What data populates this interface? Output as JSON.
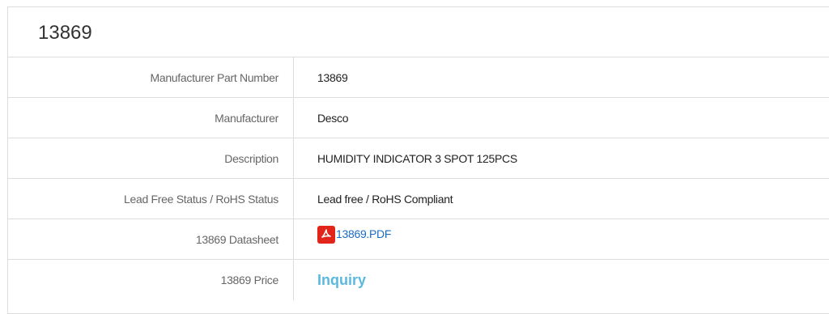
{
  "panel": {
    "title": "13869"
  },
  "rows": [
    {
      "label": "Manufacturer Part Number",
      "value": "13869"
    },
    {
      "label": "Manufacturer",
      "value": "Desco"
    },
    {
      "label": "Description",
      "value": "HUMIDITY INDICATOR 3 SPOT 125PCS"
    },
    {
      "label": "Lead Free Status / RoHS Status",
      "value": "Lead free / RoHS Compliant"
    },
    {
      "label": "13869 Datasheet",
      "link_text": "13869.PDF",
      "icon": "pdf-icon"
    },
    {
      "label": "13869 Price",
      "link_text": "Inquiry"
    }
  ],
  "colors": {
    "link": "#1a6bc4",
    "inquiry": "#5bb9de",
    "pdf_icon": "#e1251b",
    "border": "#dddddd"
  }
}
